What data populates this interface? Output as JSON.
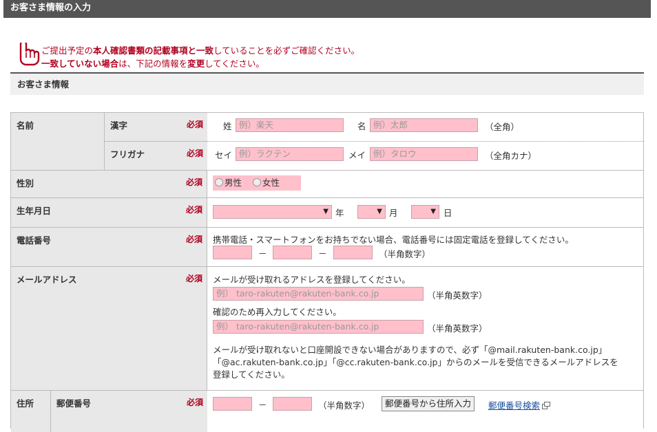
{
  "header": {
    "title": "お客さま情報の入力"
  },
  "notice": {
    "line1_a": "ご提出予定の",
    "line1_b": "本人確認書類の記載事項と一致",
    "line1_c": "していることを必ずご確認ください。",
    "line2_a": "一致していない場合",
    "line2_b": "は、下記の情報を",
    "line2_c": "変更",
    "line2_d": "してください。"
  },
  "section": {
    "title": "お客さま情報"
  },
  "required": "必須",
  "name": {
    "label": "名前",
    "kanji_label": "漢字",
    "kana_label": "フリガナ",
    "sei": "姓",
    "mei": "名",
    "sei_kana": "セイ",
    "mei_kana": "メイ",
    "kanji_last_ph": "例）楽天",
    "kanji_first_ph": "例）太郎",
    "kana_last_ph": "例）ラクテン",
    "kana_first_ph": "例）タロウ",
    "hint_kanji": "（全角）",
    "hint_kana": "（全角カナ）"
  },
  "gender": {
    "label": "性別",
    "male": "男性",
    "female": "女性"
  },
  "birth": {
    "label": "生年月日",
    "year": "年",
    "month": "月",
    "day": "日"
  },
  "phone": {
    "label": "電話番号",
    "note": "携帯電話・スマートフォンをお持ちでない場合、電話番号には固定電話を登録してください。",
    "dash": "－",
    "hint": "（半角数字）"
  },
  "email": {
    "label": "メールアドレス",
    "note1": "メールが受け取れるアドレスを登録してください。",
    "placeholder": "例） taro-rakuten@rakuten-bank.co.jp",
    "hint": "（半角英数字）",
    "note2": "確認のため再入力してください。",
    "warn1": "メールが受け取れないと口座開設できない場合がありますので、必ず「@mail.rakuten-bank.co.jp」",
    "warn2": "「@ac.rakuten-bank.co.jp」「@cc.rakuten-bank.co.jp」からのメールを受信できるメールアドレスを",
    "warn3": "登録してください。"
  },
  "address": {
    "label": "住所",
    "postal_label": "郵便番号",
    "dash": "－",
    "hint": "（半角数字）",
    "lookup_button": "郵便番号から住所入力",
    "search_link": "郵便番号検索"
  },
  "colors": {
    "required": "#b0001e",
    "field": "#ffc0cb",
    "header": "#555555",
    "link": "#1a4fa0"
  }
}
